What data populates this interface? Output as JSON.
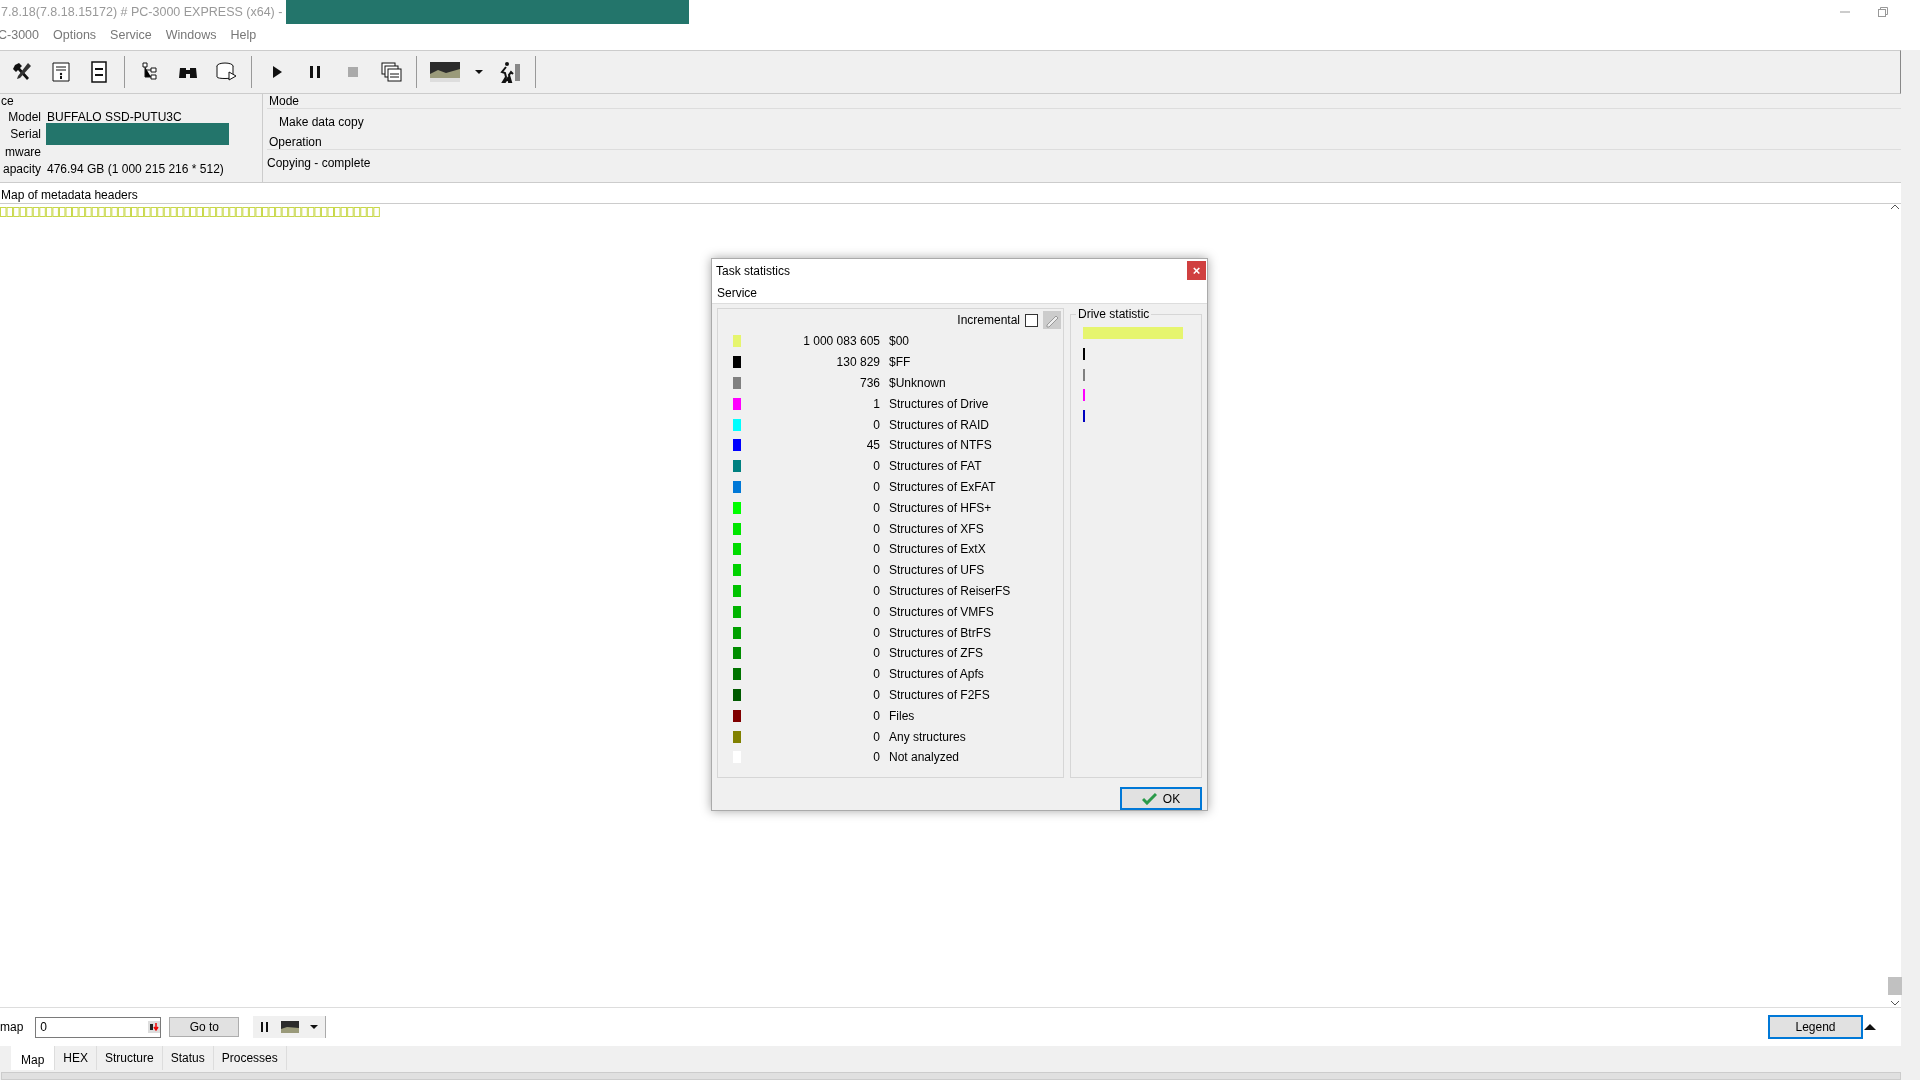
{
  "window": {
    "title": "7.8.18(7.8.18.15172) # PC-3000 EXPRESS (x64) -",
    "title_redacted": true
  },
  "menu": [
    "C-3000",
    "Options",
    "Service",
    "Windows",
    "Help"
  ],
  "device": {
    "heading": "ce",
    "fields": [
      {
        "label": "Model",
        "kind": "text",
        "value": "BUFFALO SSD-PUTU3C"
      },
      {
        "label": "Serial",
        "kind": "redacted"
      },
      {
        "label": "mware",
        "kind": "text"
      },
      {
        "label": "apacity",
        "kind": "text",
        "value": "476.94 GB (1 000 215 216 * 512)"
      }
    ]
  },
  "mode": {
    "heading": "Mode",
    "value": "Make data copy"
  },
  "operation": {
    "heading": "Operation",
    "value": "Copying - complete"
  },
  "map": {
    "title": "Map of metadata headers"
  },
  "bottom_bar": {
    "label": "map",
    "position_value": "0",
    "goto_button": "Go to",
    "legend_button": "Legend"
  },
  "tabs": [
    {
      "label": "Map",
      "selected": true
    },
    {
      "label": "HEX",
      "selected": false
    },
    {
      "label": "Structure",
      "selected": false
    },
    {
      "label": "Status",
      "selected": false
    },
    {
      "label": "Processes",
      "selected": false
    }
  ],
  "dialog": {
    "title": "Task statistics",
    "close_button": "×",
    "menu": "Service",
    "incremental": {
      "label": "Incremental",
      "checked": false
    },
    "drive_statistic_title": "Drive statistic",
    "ok_button": "OK",
    "rows": [
      {
        "color": "#e6f56e",
        "count": "1 000 083 605",
        "label": "$00"
      },
      {
        "color": "#000000",
        "count": "130 829",
        "label": "$FF"
      },
      {
        "color": "#808080",
        "count": "736",
        "label": "$Unknown"
      },
      {
        "color": "#ff00ff",
        "count": "1",
        "label": "Structures of Drive"
      },
      {
        "color": "#00ffff",
        "count": "0",
        "label": "Structures of RAID"
      },
      {
        "color": "#0000ff",
        "count": "45",
        "label": "Structures of NTFS"
      },
      {
        "color": "#008080",
        "count": "0",
        "label": "Structures of FAT"
      },
      {
        "color": "#0078d7",
        "count": "0",
        "label": "Structures of ExFAT"
      },
      {
        "color": "#00ff00",
        "count": "0",
        "label": "Structures of HFS+"
      },
      {
        "color": "#00e600",
        "count": "0",
        "label": "Structures of XFS"
      },
      {
        "color": "#00dc00",
        "count": "0",
        "label": "Structures of ExtX"
      },
      {
        "color": "#00d200",
        "count": "0",
        "label": "Structures of UFS"
      },
      {
        "color": "#00c300",
        "count": "0",
        "label": "Structures of ReiserFS"
      },
      {
        "color": "#00b400",
        "count": "0",
        "label": "Structures of VMFS"
      },
      {
        "color": "#00a000",
        "count": "0",
        "label": "Structures of BtrFS"
      },
      {
        "color": "#008c00",
        "count": "0",
        "label": "Structures of ZFS"
      },
      {
        "color": "#007300",
        "count": "0",
        "label": "Structures of Apfs"
      },
      {
        "color": "#005a00",
        "count": "0",
        "label": "Structures of F2FS"
      },
      {
        "color": "#800000",
        "count": "0",
        "label": "Files"
      },
      {
        "color": "#808000",
        "count": "0",
        "label": "Any structures"
      },
      {
        "color": "#ffffff",
        "count": "0",
        "label": "Not analyzed"
      }
    ]
  }
}
